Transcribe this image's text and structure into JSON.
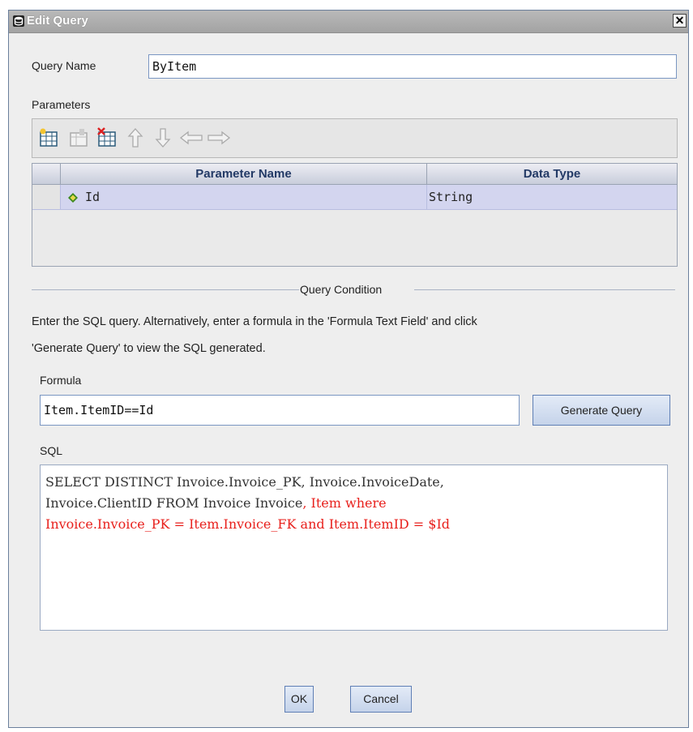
{
  "window": {
    "title": "Edit Query",
    "close_glyph": "✕"
  },
  "query_name": {
    "label": "Query Name",
    "value": "ByItem"
  },
  "parameters": {
    "label": "Parameters",
    "toolbar_icons": [
      "add-parameter-icon",
      "edit-parameter-icon",
      "delete-parameter-icon",
      "move-up-icon",
      "move-down-icon",
      "move-left-icon",
      "move-right-icon"
    ],
    "columns": [
      "Parameter Name",
      "Data Type"
    ],
    "rows": [
      {
        "name": "Id",
        "type": "String"
      }
    ]
  },
  "query_condition": {
    "heading": "Query Condition",
    "instructions_line1": "Enter the SQL query. Alternatively, enter a formula in the 'Formula Text Field' and click",
    "instructions_line2": "'Generate Query' to view the SQL generated."
  },
  "formula": {
    "label": "Formula",
    "value": "Item.ItemID==Id",
    "generate_button": "Generate Query"
  },
  "sql": {
    "label": "SQL",
    "line1": "SELECT DISTINCT Invoice.Invoice_PK, Invoice.InvoiceDate,",
    "line2_black": "Invoice.ClientID FROM Invoice  Invoice",
    "line2_red": ", Item where",
    "line3_red": "Invoice.Invoice_PK = Item.Invoice_FK and Item.ItemID = $Id"
  },
  "footer": {
    "ok": "OK",
    "cancel": "Cancel"
  },
  "colors": {
    "sql_highlight": "#e8201c",
    "selected_row": "#d3d5ef",
    "header_text": "#233a66"
  }
}
